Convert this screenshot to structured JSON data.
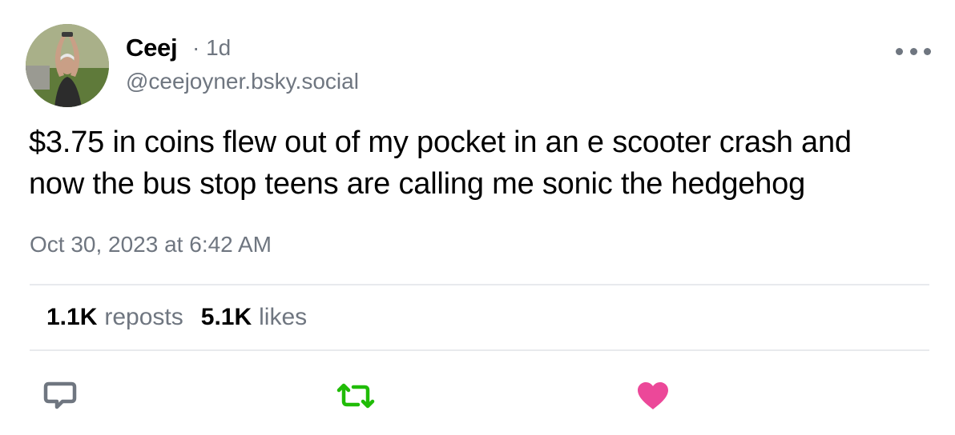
{
  "post": {
    "author": {
      "display_name": "Ceej",
      "separator_time": "· 1d",
      "handle": "@ceejoyner.bsky.social"
    },
    "text_lines": [
      "$3.75 in coins flew out of my pocket in an e scooter crash and",
      "now the bus stop teens are calling me sonic the hedgehog"
    ],
    "timestamp": "Oct 30, 2023 at 6:42 AM",
    "stats": {
      "reposts_count": "1.1K",
      "reposts_label": "reposts",
      "likes_count": "5.1K",
      "likes_label": "likes"
    },
    "actions": {
      "reply_icon": "reply-bubble-icon",
      "repost_icon": "repost-arrows-icon",
      "like_icon": "heart-icon",
      "more_icon": "ellipsis-icon"
    }
  },
  "colors": {
    "text_primary": "#000000",
    "text_secondary": "#6f7680",
    "divider": "#e8eaed",
    "reply_icon": "#6f7680",
    "repost_active": "#20bc07",
    "like_active": "#ec4899"
  }
}
